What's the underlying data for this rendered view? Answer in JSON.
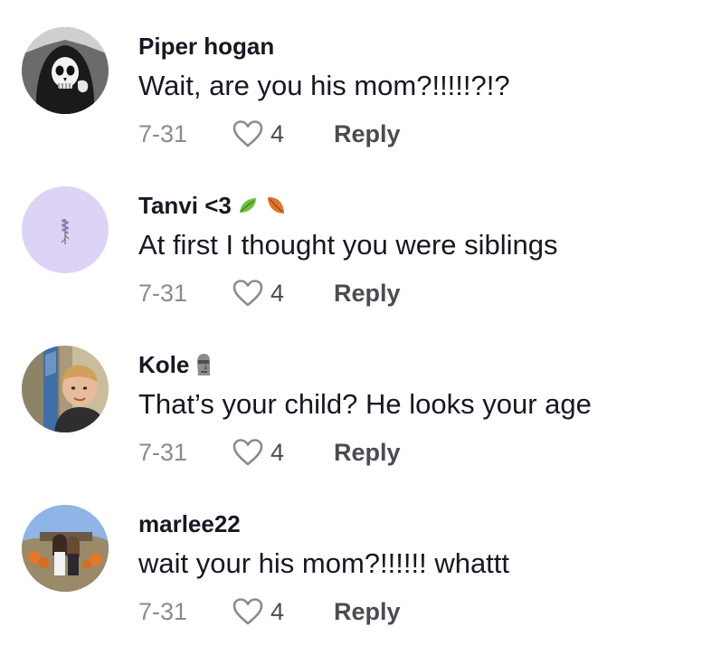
{
  "comments": [
    {
      "username": "Piper hogan",
      "text": "Wait, are you his mom?!!!!!?!?",
      "date": "7-31",
      "likes": "4",
      "reply_label": "Reply"
    },
    {
      "username": "Tanvi <3",
      "username_emoji": [
        "leaf-emoji",
        "fallen-leaf-emoji"
      ],
      "text": "At first I thought you were siblings",
      "date": "7-31",
      "likes": "4",
      "reply_label": "Reply"
    },
    {
      "username": "Kole",
      "username_emoji": [
        "moai-emoji"
      ],
      "text": "That’s your child? He looks your age",
      "date": "7-31",
      "likes": "4",
      "reply_label": "Reply"
    },
    {
      "username": "marlee22",
      "text": "wait your his mom?!!!!!! whattt",
      "date": "7-31",
      "likes": "4",
      "reply_label": "Reply"
    }
  ],
  "icons": {
    "like": "heart-outline-icon"
  },
  "colors": {
    "text": "#161823",
    "muted": "#8a8b91",
    "action": "#4b4c52",
    "avatar_lavender": "#dcd3f7"
  }
}
